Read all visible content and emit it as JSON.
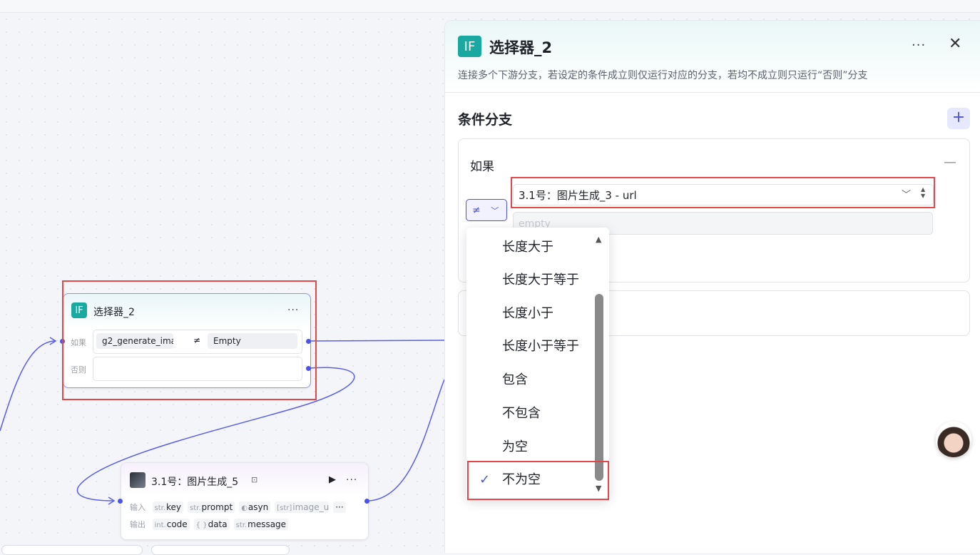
{
  "canvas": {
    "node_selector": {
      "title": "选择器_2",
      "badge": "IF",
      "more": "···",
      "if_label": "如果",
      "else_label": "否则",
      "left_var": "g2_generate_ima···",
      "operator": "≠",
      "right_value": "Empty"
    },
    "node_image": {
      "title": "3.1号：图片生成_5",
      "run": "▶",
      "more": "···",
      "input_label": "输入",
      "output_label": "输出",
      "inputs": [
        {
          "type": "str.",
          "name": "key"
        },
        {
          "type": "str.",
          "name": "prompt"
        },
        {
          "type": "◐",
          "name": "asyn"
        },
        {
          "type": "[str]",
          "name": "image_url"
        }
      ],
      "inputs_more": "···",
      "outputs": [
        {
          "type": "int.",
          "name": "code"
        },
        {
          "type": "{ }",
          "name": "data"
        },
        {
          "type": "str.",
          "name": "message"
        }
      ]
    }
  },
  "panel": {
    "badge": "IF",
    "title": "选择器_2",
    "more": "···",
    "close": "✕",
    "description": "连接多个下游分支，若设定的条件成立则仅运行对应的分支，若均不成立则只运行“否则”分支",
    "section_title": "条件分支",
    "add": "+",
    "branch_label": "如果",
    "collapse": "—",
    "operator_symbol": "≠",
    "variable_value": "3.1号：图片生成_3 - url",
    "value_placeholder": "empty"
  },
  "dropdown": {
    "options": [
      "长度大于",
      "长度大于等于",
      "长度小于",
      "长度小于等于",
      "包含",
      "不包含",
      "为空",
      "不为空"
    ],
    "selected": "不为空"
  },
  "colors": {
    "accent": "#4d53e8",
    "if_badge": "#1aa9a0",
    "highlight": "#e0484b"
  }
}
